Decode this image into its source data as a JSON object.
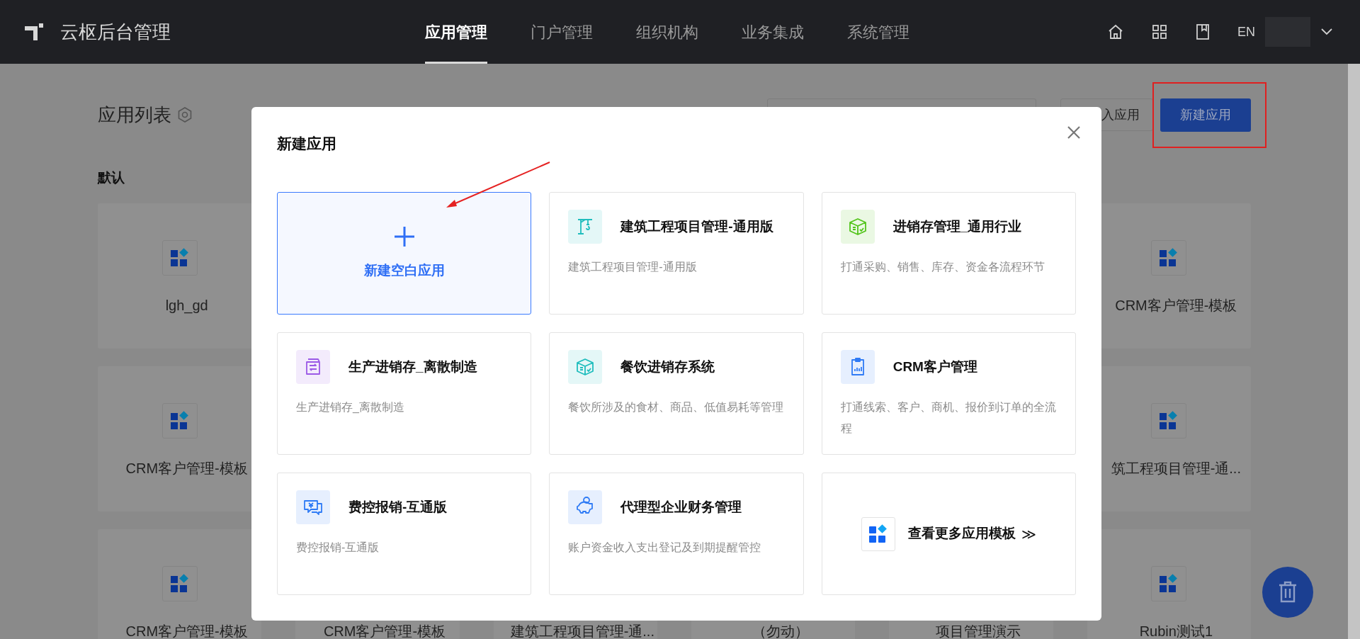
{
  "header": {
    "title": "云枢后台管理",
    "nav": [
      {
        "label": "应用管理",
        "selected": true
      },
      {
        "label": "门户管理",
        "selected": false
      },
      {
        "label": "组织机构",
        "selected": false
      },
      {
        "label": "业务集成",
        "selected": false
      },
      {
        "label": "系统管理",
        "selected": false
      }
    ],
    "language": "EN"
  },
  "page": {
    "title": "应用列表",
    "group": "默认",
    "import_button": "入应用",
    "new_button": "新建应用",
    "app_rows": [
      [
        {
          "label": "lgh_gd"
        },
        {
          "label": "CRM客户管理-模板"
        }
      ],
      [
        {
          "label": "CRM客户管理-模板"
        },
        {
          "label": "筑工程项目管理-通..."
        }
      ],
      [
        {
          "label": "CRM客户管理-模板"
        },
        {
          "label": "CRM客户管理-模板"
        },
        {
          "label": "建筑工程项目管理-通..."
        },
        {
          "label": "（勿动）"
        },
        {
          "label": "项目管理演示"
        },
        {
          "label": "Rubin测试1"
        }
      ]
    ]
  },
  "dialog": {
    "title": "新建应用",
    "cards": [
      {
        "kind": "blank",
        "title": "新建空白应用",
        "selected": true
      },
      {
        "kind": "template",
        "title": "建筑工程项目管理-通用版",
        "description": "建筑工程项目管理-通用版",
        "color": "#1fbdbd"
      },
      {
        "kind": "template",
        "title": "进销存管理_通用行业",
        "description": "打通采购、销售、库存、资金各流程环节",
        "color": "#52c41a"
      },
      {
        "kind": "template",
        "title": "生产进销存_离散制造",
        "description": "生产进销存_离散制造",
        "color": "#9b59e6"
      },
      {
        "kind": "template",
        "title": "餐饮进销存系统",
        "description": "餐饮所涉及的食材、商品、低值易耗等管理",
        "color": "#1fbdbd"
      },
      {
        "kind": "template",
        "title": "CRM客户管理",
        "description": "打通线索、客户、商机、报价到订单的全流程",
        "color": "#2f7bf5"
      },
      {
        "kind": "template",
        "title": "费控报销-互通版",
        "description": "费控报销-互通版",
        "color": "#2f7bf5"
      },
      {
        "kind": "template",
        "title": "代理型企业财务管理",
        "description": "账户资金收入支出登记及到期提醒管控",
        "color": "#2f7bf5"
      },
      {
        "kind": "more",
        "title": "查看更多应用模板",
        "arrow": "≫"
      }
    ]
  }
}
